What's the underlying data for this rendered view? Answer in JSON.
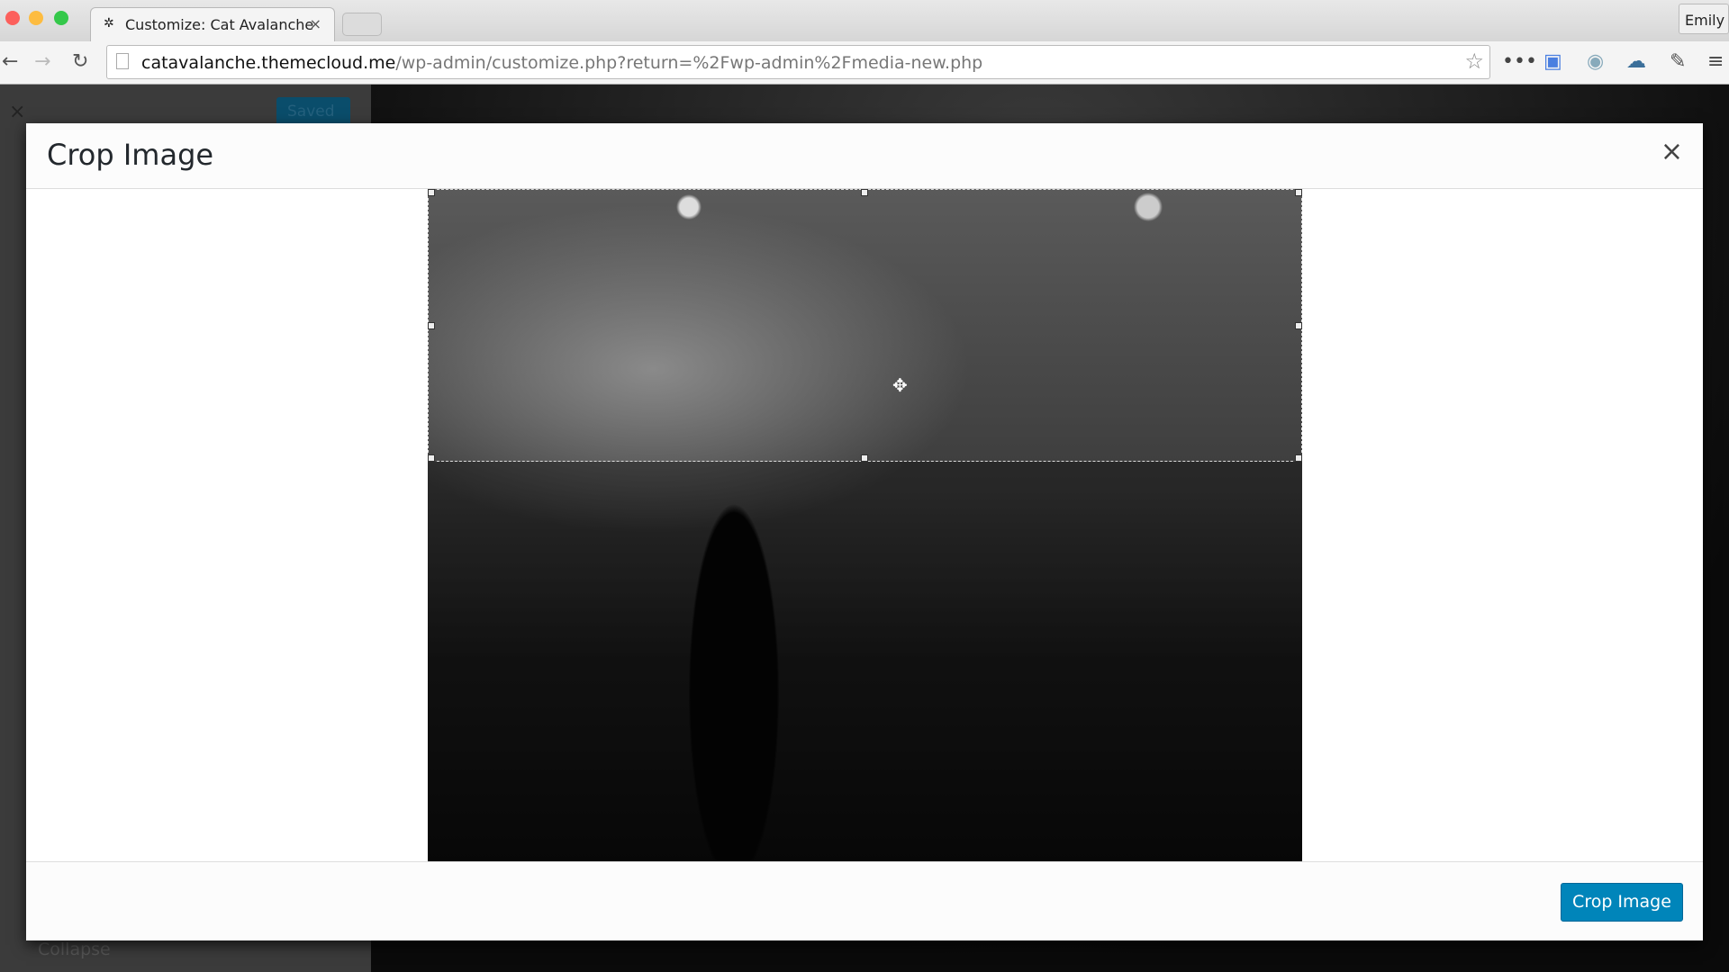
{
  "browser": {
    "tab_title": "Customize: Cat Avalanche",
    "tab_close": "×",
    "user": "Emily",
    "url_host": "catavalanche.themecloud.me",
    "url_path": "/wp-admin/customize.php?return=%2Fwp-admin%2Fmedia-new.php",
    "icons": [
      "back-icon",
      "forward-icon",
      "reload-icon",
      "star-icon",
      "more-icon",
      "translate-icon",
      "camera-icon",
      "cloud-icon",
      "eyedropper-icon",
      "menu-icon"
    ]
  },
  "customizer": {
    "close": "×",
    "saved_label": "Saved",
    "collapse_label": "Collapse"
  },
  "modal": {
    "title": "Crop Image",
    "close": "×",
    "crop_button": "Crop Image"
  },
  "colors": {
    "primary_button": "#0085ba"
  }
}
